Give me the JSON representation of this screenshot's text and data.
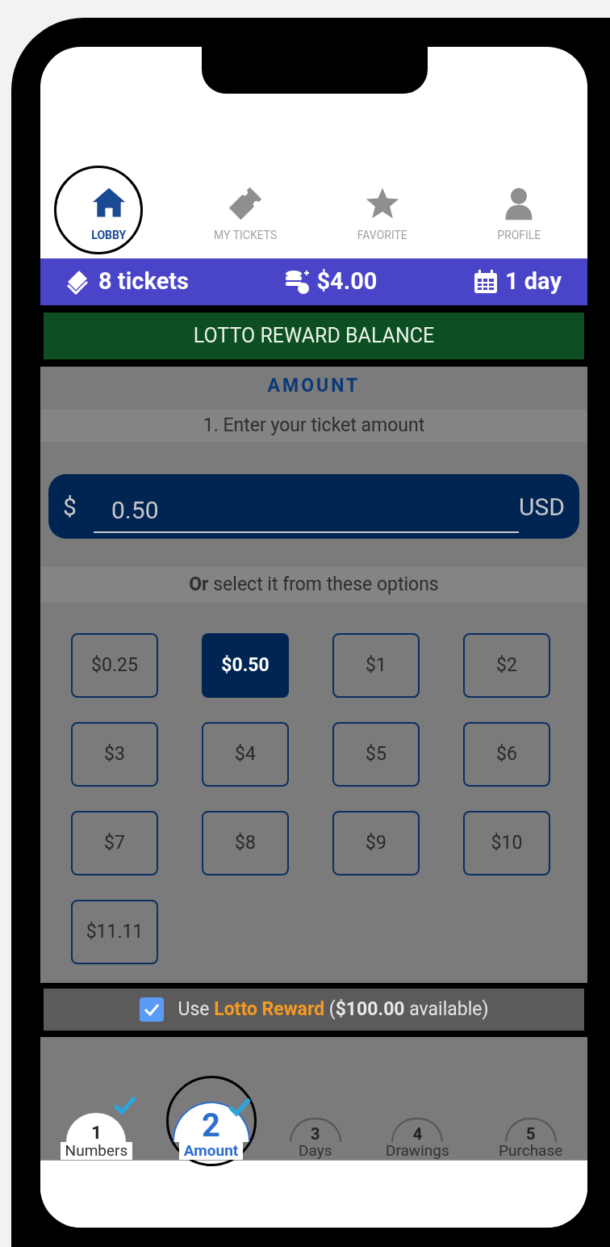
{
  "nav_tabs": [
    {
      "label": "LOBBY",
      "kind": "home",
      "selected": true
    },
    {
      "label": "MY TICKETS",
      "kind": "ticket",
      "selected": false
    },
    {
      "label": "FAVORITE",
      "kind": "star",
      "selected": false
    },
    {
      "label": "PROFILE",
      "kind": "person",
      "selected": false
    }
  ],
  "stats": [
    {
      "text": "8 tickets",
      "kind": "tickets"
    },
    {
      "text": "$4.00",
      "kind": "money"
    },
    {
      "text": "1 day",
      "kind": "days"
    }
  ],
  "banner": "LOTTO REWARD BALANCE",
  "section_title": "AMOUNT",
  "instruction": "1. Enter your ticket amount",
  "amount_field": {
    "prefix": "$",
    "value": "0.50",
    "suffix": "USD"
  },
  "options_label": "**Or** select it from these options",
  "options": [
    {
      "label": "$0.25",
      "selected": false
    },
    {
      "label": "$0.50",
      "selected": true
    },
    {
      "label": "$1",
      "selected": false
    },
    {
      "label": "$2",
      "selected": false
    },
    {
      "label": "$3",
      "selected": false
    },
    {
      "label": "$4",
      "selected": false
    },
    {
      "label": "$5",
      "selected": false
    },
    {
      "label": "$6",
      "selected": false
    },
    {
      "label": "$7",
      "selected": false
    },
    {
      "label": "$8",
      "selected": false
    },
    {
      "label": "$9",
      "selected": false
    },
    {
      "label": "$10",
      "selected": false
    },
    {
      "label": "$11.11",
      "selected": false
    }
  ],
  "reward": {
    "checked": true,
    "prefix": "Use",
    "highlight": "Lotto Reward",
    "rest": "(**$100.00** available)"
  },
  "steps": [
    {
      "number": "1",
      "label": "Numbers",
      "done": true,
      "selected": false
    },
    {
      "number": "2",
      "label": "Amount",
      "done": true,
      "selected": true
    },
    {
      "number": "3",
      "label": "Days",
      "done": false,
      "selected": false
    },
    {
      "number": "4",
      "label": "Drawings",
      "done": false,
      "selected": false
    },
    {
      "number": "5",
      "label": "Purchase",
      "done": false,
      "selected": false
    }
  ]
}
